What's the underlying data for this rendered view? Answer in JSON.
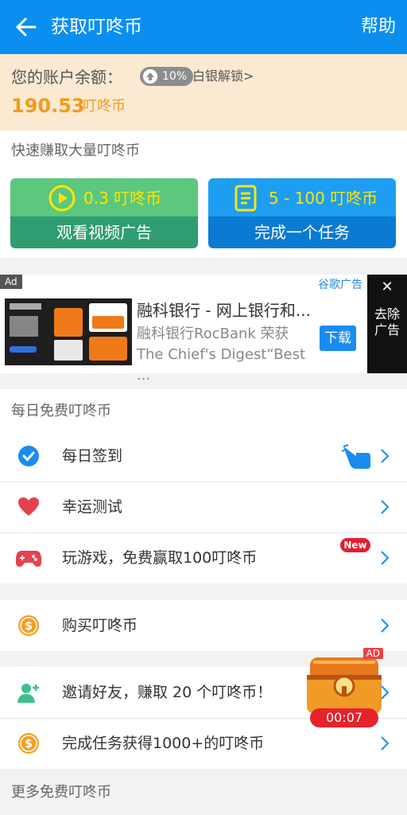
{
  "header": {
    "title": "获取叮咚币",
    "help": "帮助"
  },
  "balance": {
    "label": "您的账户余额：",
    "badge": "10%",
    "unlock": "白银解锁>",
    "amount": "190.53",
    "unit": "叮咚币"
  },
  "quick": {
    "title": "快速赚取大量叮咚币",
    "video": {
      "amount": "0.3 叮咚币",
      "label": "观看视频广告"
    },
    "task": {
      "amount": "5 - 100 叮咚币",
      "label": "完成一个任务"
    }
  },
  "ad": {
    "tag": "Ad",
    "network": "谷歌广告",
    "title": "融科银行 - 网上银行和...",
    "desc": "融科银行RocBank 荣获 The Chief's Digest“Best ...",
    "download": "下载",
    "remove": [
      "去除",
      "广告"
    ]
  },
  "daily": {
    "title": "每日免费叮咚币",
    "items": [
      {
        "label": "每日签到",
        "icon": "check-circle-icon"
      },
      {
        "label": "幸运测试",
        "icon": "heart-icon"
      },
      {
        "label": "玩游戏，免费赢取100叮咚币",
        "icon": "gamepad-icon",
        "badge": "New"
      }
    ]
  },
  "buy": {
    "label": "购买叮咚币",
    "icon": "coin-icon"
  },
  "more_items": [
    {
      "label": "邀请好友，赚取 20 个叮咚币！",
      "icon": "add-user-icon"
    },
    {
      "label": "完成任务获得1000+的叮咚币",
      "icon": "coin-icon"
    }
  ],
  "more": {
    "title": "更多免费叮咚币"
  },
  "chest": {
    "ad": "AD",
    "timer": "00:07"
  },
  "colors": {
    "primary": "#0a8ff0",
    "orange": "#f39a1c",
    "green": "#5cc77f",
    "red": "#e0202f"
  }
}
